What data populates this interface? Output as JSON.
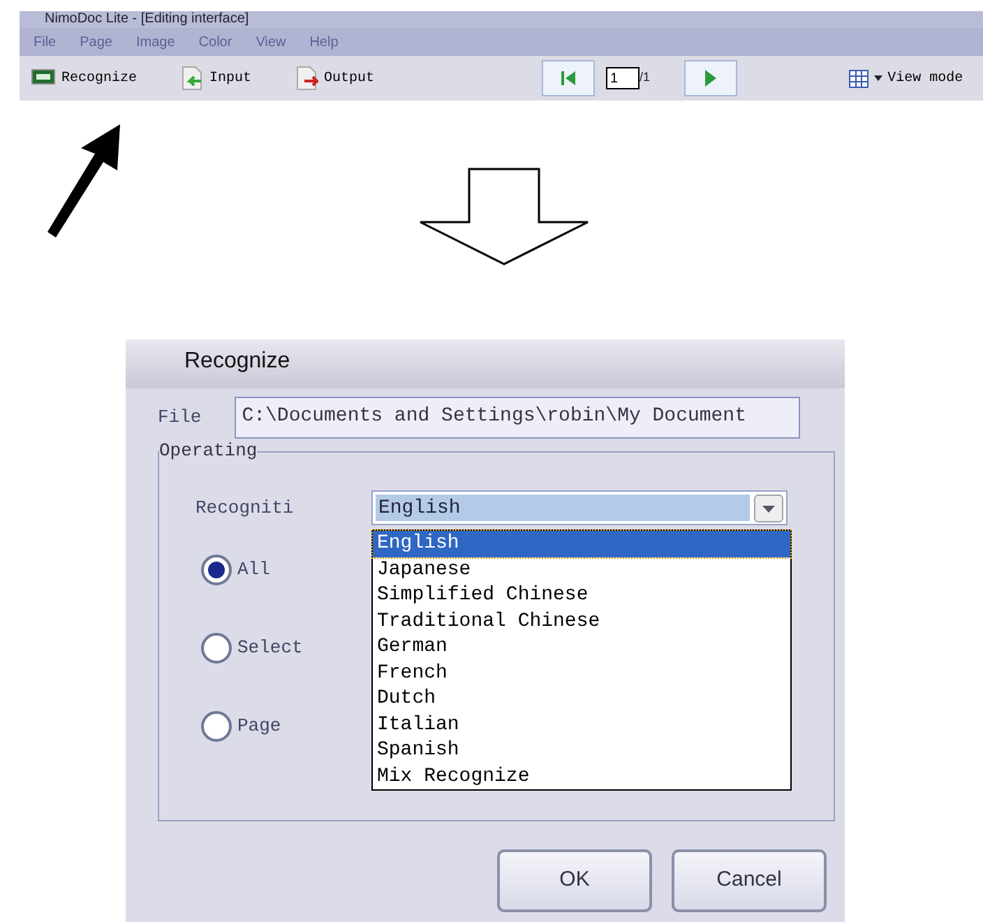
{
  "app_window": {
    "title": "NimoDoc Lite - [Editing interface]",
    "menu": [
      "File",
      "Page",
      "Image",
      "Color",
      "View",
      "Help"
    ],
    "toolbar": [
      {
        "kind": "recognize",
        "label": "Recognize"
      },
      {
        "kind": "input",
        "label": "Input"
      },
      {
        "kind": "output",
        "label": "Output"
      }
    ],
    "page_field": {
      "value": "1"
    },
    "page_count": "/1",
    "view_mode": "View mode"
  },
  "dialog": {
    "title": "Recognize",
    "file_label": "File",
    "file_value": "C:\\Documents and Settings\\robin\\My Document",
    "group_title": "Operating",
    "language_label": "Recogniti",
    "language_value": "English",
    "dropdown_open": true,
    "languages": [
      {
        "label": "English",
        "selected": true
      },
      {
        "label": "Japanese",
        "selected": false
      },
      {
        "label": "Simplified Chinese",
        "selected": false
      },
      {
        "label": "Traditional Chinese",
        "selected": false
      },
      {
        "label": "German",
        "selected": false
      },
      {
        "label": "French",
        "selected": false
      },
      {
        "label": "Dutch",
        "selected": false
      },
      {
        "label": "Italian",
        "selected": false
      },
      {
        "label": "Spanish",
        "selected": false
      },
      {
        "label": "Mix Recognize",
        "selected": false
      }
    ],
    "scope": [
      {
        "label": "All",
        "selected": true
      },
      {
        "label": "Select",
        "selected": false
      },
      {
        "label": "Page",
        "selected": false
      }
    ],
    "buttons": [
      "OK",
      "Cancel"
    ]
  }
}
